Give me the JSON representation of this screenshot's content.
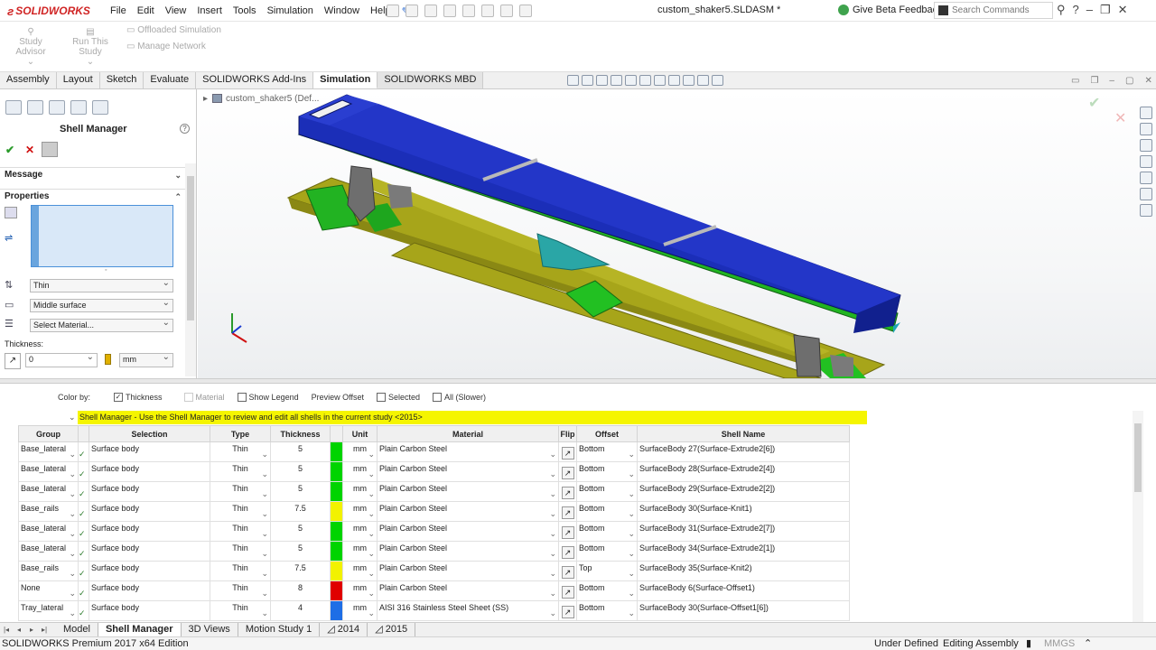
{
  "app": {
    "logo": "SOLIDWORKS",
    "document_title": "custom_shaker5.SLDASM *"
  },
  "menu": [
    "File",
    "Edit",
    "View",
    "Insert",
    "Tools",
    "Simulation",
    "Window",
    "Help"
  ],
  "header": {
    "feedback": "Give Beta Feedback",
    "search_placeholder": "Search Commands"
  },
  "ribbon": {
    "study_advisor": "Study Advisor",
    "run_this_study": "Run This Study",
    "offloaded_simulation": "Offloaded Simulation",
    "manage_network": "Manage Network"
  },
  "tabs": [
    "Assembly",
    "Layout",
    "Sketch",
    "Evaluate",
    "SOLIDWORKS Add-Ins",
    "Simulation",
    "SOLIDWORKS MBD"
  ],
  "active_tab": "Simulation",
  "tree": {
    "root": "custom_shaker5 (Def..."
  },
  "left_panel": {
    "title": "Shell Manager",
    "message_label": "Message",
    "properties_label": "Properties",
    "type_value": "Thin",
    "offset_value": "Middle surface",
    "material_value": "Select Material...",
    "thickness_label": "Thickness:",
    "thickness_value": "0",
    "unit_value": "mm"
  },
  "color_by": {
    "label": "Color by:",
    "options": [
      {
        "label": "Thickness",
        "checked": true,
        "enabled": true
      },
      {
        "label": "Material",
        "checked": false,
        "enabled": false
      },
      {
        "label": "Show Legend",
        "checked": false,
        "enabled": true
      },
      {
        "label": "Preview Offset",
        "checked": false,
        "enabled": true
      },
      {
        "label": "Selected",
        "checked": false,
        "enabled": true
      },
      {
        "label": "All (Slower)",
        "checked": false,
        "enabled": true
      }
    ]
  },
  "grid": {
    "banner": "Shell Manager - Use the Shell Manager to review and edit all shells in the current study <2015>",
    "columns": [
      "Group",
      "Selection",
      "Type",
      "Thickness",
      "Unit",
      "Material",
      "Flip",
      "Offset",
      "Shell Name"
    ],
    "rows": [
      {
        "group": "Base_lateral",
        "selection": "Surface body",
        "type": "Thin",
        "thickness": "5",
        "color": "#00d400",
        "unit": "mm",
        "material": "Plain Carbon Steel",
        "offset": "Bottom",
        "shell": "SurfaceBody 27(Surface-Extrude2[6])"
      },
      {
        "group": "Base_lateral",
        "selection": "Surface body",
        "type": "Thin",
        "thickness": "5",
        "color": "#00d400",
        "unit": "mm",
        "material": "Plain Carbon Steel",
        "offset": "Bottom",
        "shell": "SurfaceBody 28(Surface-Extrude2[4])"
      },
      {
        "group": "Base_lateral",
        "selection": "Surface body",
        "type": "Thin",
        "thickness": "5",
        "color": "#00d400",
        "unit": "mm",
        "material": "Plain Carbon Steel",
        "offset": "Bottom",
        "shell": "SurfaceBody 29(Surface-Extrude2[2])"
      },
      {
        "group": "Base_rails",
        "selection": "Surface body",
        "type": "Thin",
        "thickness": "7.5",
        "color": "#f2f200",
        "unit": "mm",
        "material": "Plain Carbon Steel",
        "offset": "Bottom",
        "shell": "SurfaceBody 30(Surface-Knit1)"
      },
      {
        "group": "Base_lateral",
        "selection": "Surface body",
        "type": "Thin",
        "thickness": "5",
        "color": "#00d400",
        "unit": "mm",
        "material": "Plain Carbon Steel",
        "offset": "Bottom",
        "shell": "SurfaceBody 31(Surface-Extrude2[7])"
      },
      {
        "group": "Base_lateral",
        "selection": "Surface body",
        "type": "Thin",
        "thickness": "5",
        "color": "#00d400",
        "unit": "mm",
        "material": "Plain Carbon Steel",
        "offset": "Bottom",
        "shell": "SurfaceBody 34(Surface-Extrude2[1])"
      },
      {
        "group": "Base_rails",
        "selection": "Surface body",
        "type": "Thin",
        "thickness": "7.5",
        "color": "#f2f200",
        "unit": "mm",
        "material": "Plain Carbon Steel",
        "offset": "Top",
        "shell": "SurfaceBody 35(Surface-Knit2)"
      },
      {
        "group": "None",
        "selection": "Surface body",
        "type": "Thin",
        "thickness": "8",
        "color": "#e00000",
        "unit": "mm",
        "material": "Plain Carbon Steel",
        "offset": "Bottom",
        "shell": "SurfaceBody 6(Surface-Offset1)"
      },
      {
        "group": "Tray_lateral",
        "selection": "Surface body",
        "type": "Thin",
        "thickness": "4",
        "color": "#1e6ee6",
        "unit": "mm",
        "material": "AISI 316 Stainless Steel Sheet (SS)",
        "offset": "Bottom",
        "shell": "SurfaceBody 30(Surface-Offset1[6])"
      }
    ]
  },
  "sheet_tabs": [
    "Model",
    "Shell Manager",
    "3D Views",
    "Motion Study 1",
    "2014",
    "2015"
  ],
  "active_sheet": "Shell Manager",
  "status": {
    "edition": "SOLIDWORKS Premium 2017 x64 Edition",
    "state": "Under Defined",
    "mode": "Editing Assembly",
    "units": "MMGS"
  }
}
